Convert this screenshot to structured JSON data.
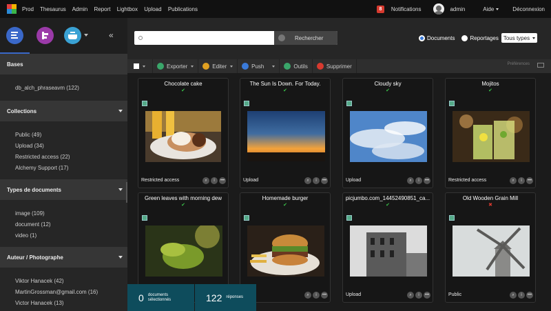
{
  "topnav": {
    "items": [
      "Prod",
      "Thesaurus",
      "Admin",
      "Report",
      "Lightbox",
      "Upload",
      "Publications"
    ],
    "notif_count": "8",
    "notifications_label": "Notifications",
    "user": "admin",
    "help": "Aide",
    "logout": "Déconnexion"
  },
  "sidebar": {
    "sections": [
      {
        "title": "Bases",
        "items": [
          "db_alch_phraseavm (122)"
        ]
      },
      {
        "title": "Collections",
        "items": [
          "Public (49)",
          "Upload (34)",
          "Restricted access (22)",
          "Alchemy Support (17)"
        ]
      },
      {
        "title": "Types de documents",
        "items": [
          "image (109)",
          "document (12)",
          "video (1)"
        ]
      },
      {
        "title": "Auteur / Photographe",
        "items": [
          "Viktor Hanacek (42)",
          "MartinGrossman@gmail.com (16)",
          "Victor Hanacek (13)"
        ]
      }
    ]
  },
  "search": {
    "placeholder": "",
    "button_label": "Rechercher",
    "radio_documents": "Documents",
    "radio_reportages": "Reportages",
    "type_select": "Tous types"
  },
  "actions": {
    "export": "Exporter",
    "edit": "Editer",
    "push": "Push",
    "tools": "Outils",
    "delete": "Supprimer",
    "preferences": "Préférences"
  },
  "colors": {
    "export": "#3aa66a",
    "edit": "#e0a021",
    "push": "#3a7ad9",
    "tools": "#3aa66a",
    "delete": "#d73a2f"
  },
  "records": [
    {
      "title": "Chocolate cake",
      "status": "✔",
      "status_color": "#3ac24a",
      "collection": "Restricted access"
    },
    {
      "title": "The Sun Is Down. For Today.",
      "status": "✔",
      "status_color": "#3ac24a",
      "collection": "Upload"
    },
    {
      "title": "Cloudy sky",
      "status": "✔",
      "status_color": "#3ac24a",
      "collection": "Upload"
    },
    {
      "title": "Mojitos",
      "status": "✔",
      "status_color": "#3ac24a",
      "collection": "Restricted access"
    },
    {
      "title": "Green leaves with morning dew",
      "status": "✔",
      "status_color": "#3ac24a",
      "collection": ""
    },
    {
      "title": "Homemade burger",
      "status": "✔",
      "status_color": "#3ac24a",
      "collection": "d"
    },
    {
      "title": "picjumbo.com_14452490851_ca...",
      "status": "✔",
      "status_color": "#3ac24a",
      "collection": "Upload"
    },
    {
      "title": "Old Wooden Grain Mill",
      "status": "✖",
      "status_color": "#d73a2f",
      "collection": "Public"
    }
  ],
  "selection": {
    "count": "0",
    "count_label_1": "documents",
    "count_label_2": "sélectionnés",
    "results": "122",
    "results_label": "réponses"
  }
}
